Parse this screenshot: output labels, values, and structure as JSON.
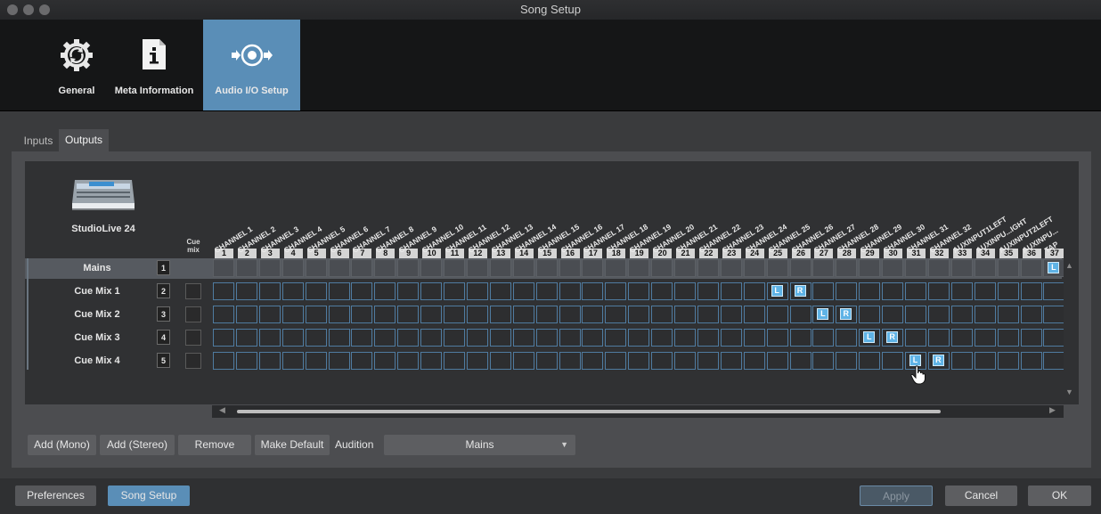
{
  "window": {
    "title": "Song Setup"
  },
  "toolbar": [
    {
      "label": "General",
      "icon": "sync-gear-icon"
    },
    {
      "label": "Meta Information",
      "icon": "info-document-icon"
    },
    {
      "label": "Audio I/O Setup",
      "icon": "audio-io-icon",
      "active": true
    }
  ],
  "tabs": [
    {
      "label": "Inputs"
    },
    {
      "label": "Outputs",
      "active": true
    }
  ],
  "device": {
    "name": "StudioLive 24",
    "icon": "mixer-console-icon"
  },
  "matrix": {
    "cue_mix_header": [
      "Cue",
      "mix"
    ],
    "columns": [
      "CHANNEL 1",
      "CHANNEL 2",
      "CHANNEL 3",
      "CHANNEL 4",
      "CHANNEL 5",
      "CHANNEL 6",
      "CHANNEL 7",
      "CHANNEL 8",
      "CHANNEL 9",
      "CHANNEL 10",
      "CHANNEL 11",
      "CHANNEL 12",
      "CHANNEL 13",
      "CHANNEL 14",
      "CHANNEL 15",
      "CHANNEL 16",
      "CHANNEL 17",
      "CHANNEL 18",
      "CHANNEL 19",
      "CHANNEL 20",
      "CHANNEL 21",
      "CHANNEL 22",
      "CHANNEL 23",
      "CHANNEL 24",
      "CHANNEL 25",
      "CHANNEL 26",
      "CHANNEL 27",
      "CHANNEL 28",
      "CHANNEL 29",
      "CHANNEL 30",
      "CHANNEL 31",
      "CHANNEL 32",
      "AUXINPUT1LEFT",
      "AUXINPU...IGHT",
      "AUXINPUT2LEFT",
      "AUXINPU...",
      "TAP"
    ],
    "column_numbers": [
      "1",
      "2",
      "3",
      "4",
      "5",
      "6",
      "7",
      "8",
      "9",
      "10",
      "11",
      "12",
      "13",
      "14",
      "15",
      "16",
      "17",
      "18",
      "19",
      "20",
      "21",
      "22",
      "23",
      "24",
      "25",
      "26",
      "27",
      "28",
      "29",
      "30",
      "31",
      "32",
      "33",
      "34",
      "35",
      "36",
      "37"
    ],
    "rows": [
      {
        "name": "Mains",
        "number": "1",
        "assign": [
          {
            "col": 37,
            "label": "L"
          }
        ]
      },
      {
        "name": "Cue Mix 1",
        "number": "2",
        "assign": [
          {
            "col": 25,
            "label": "L"
          },
          {
            "col": 26,
            "label": "R"
          }
        ]
      },
      {
        "name": "Cue Mix 2",
        "number": "3",
        "assign": [
          {
            "col": 27,
            "label": "L"
          },
          {
            "col": 28,
            "label": "R"
          }
        ]
      },
      {
        "name": "Cue Mix 3",
        "number": "4",
        "assign": [
          {
            "col": 29,
            "label": "L"
          },
          {
            "col": 30,
            "label": "R"
          }
        ]
      },
      {
        "name": "Cue Mix 4",
        "number": "5",
        "assign": [
          {
            "col": 31,
            "label": "L"
          },
          {
            "col": 32,
            "label": "R"
          }
        ]
      }
    ]
  },
  "buttons": {
    "add_mono": "Add (Mono)",
    "add_stereo": "Add (Stereo)",
    "remove": "Remove",
    "make_default": "Make Default",
    "audition_label": "Audition",
    "audition_value": "Mains"
  },
  "footer": {
    "preferences": "Preferences",
    "song_setup": "Song Setup",
    "apply": "Apply",
    "cancel": "Cancel",
    "ok": "OK"
  },
  "colors": {
    "accent": "#5a8eb7",
    "assign": "#5fb3e6"
  }
}
